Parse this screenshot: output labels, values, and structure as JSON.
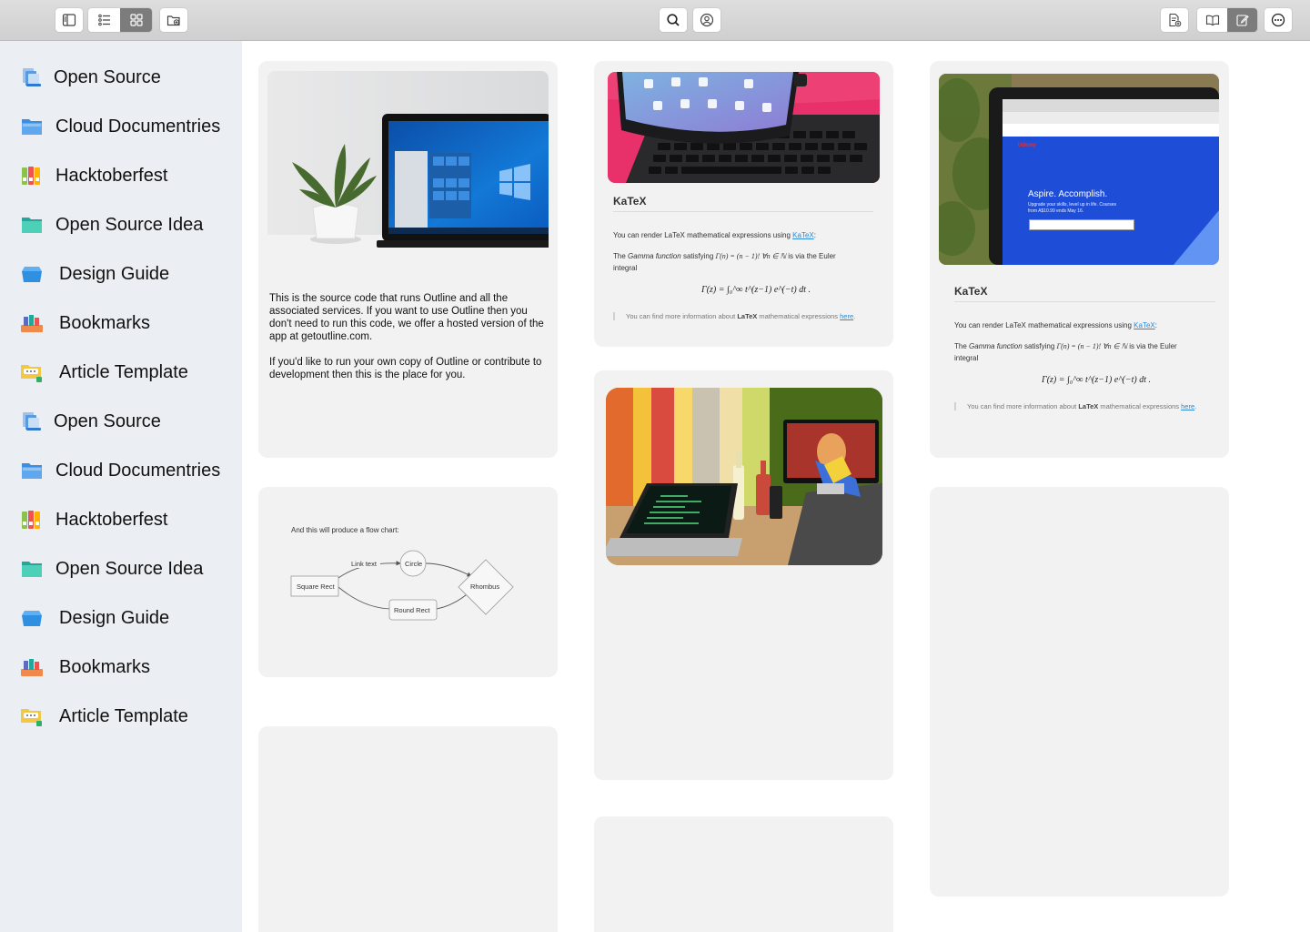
{
  "toolbar": {
    "left": [
      "sidebar-toggle-icon",
      "list-view-icon",
      "grid-view-icon",
      "new-folder-icon"
    ],
    "center": [
      "search-icon",
      "account-icon"
    ],
    "right": [
      "new-document-icon",
      "reader-mode-icon",
      "edit-mode-icon",
      "more-icon"
    ],
    "active_view": "grid",
    "active_mode": "edit"
  },
  "sidebar": {
    "items": [
      {
        "label": "Open Source",
        "icon": "document-stack-icon"
      },
      {
        "label": "Cloud Documentries",
        "icon": "blue-folder-icon"
      },
      {
        "label": "Hacktoberfest",
        "icon": "binders-icon"
      },
      {
        "label": "Open Source Idea",
        "icon": "teal-folder-icon"
      },
      {
        "label": "Design Guide",
        "icon": "open-box-icon"
      },
      {
        "label": "Bookmarks",
        "icon": "books-icon"
      },
      {
        "label": "Article Template",
        "icon": "comment-folder-icon"
      },
      {
        "label": "Open Source",
        "icon": "document-stack-icon"
      },
      {
        "label": "Cloud Documentries",
        "icon": "blue-folder-icon"
      },
      {
        "label": "Hacktoberfest",
        "icon": "binders-icon"
      },
      {
        "label": "Open Source Idea",
        "icon": "teal-folder-icon"
      },
      {
        "label": "Design Guide",
        "icon": "open-box-icon"
      },
      {
        "label": "Bookmarks",
        "icon": "books-icon"
      },
      {
        "label": "Article Template",
        "icon": "comment-folder-icon"
      }
    ]
  },
  "cards": {
    "outline": {
      "image": "laptop-with-plant-photo",
      "paragraph1": "This is the source code that runs Outline and all the associated services. If you want to use Outline then you don't need to run this code, we offer a hosted version of the app at getoutline.com.",
      "paragraph2": "If you'd like to run your own copy of Outline or contribute to development then this is the place for you."
    },
    "flowchart": {
      "intro": "And this will produce a flow chart:",
      "nodes": {
        "square": "Square Rect",
        "circle": "Circle",
        "round": "Round Rect",
        "rhombus": "Rhombus"
      },
      "edge_label": "Link text"
    },
    "katex": {
      "title": "KaTeX",
      "line1_prefix": "You can render LaTeX mathematical expressions using ",
      "line1_link": "KaTeX",
      "line1_suffix": ":",
      "line2_prefix": "The ",
      "line2_em": "Gamma function",
      "line2_mid": " satisfying ",
      "line2_math": "Γ(n) = (n − 1)!   ∀n ∈ ℕ",
      "line2_suffix": " is via the Euler",
      "line3": "integral",
      "formula": "Γ(z) = ∫₀^∞ t^(z−1) e^(−t) dt .",
      "quote_prefix": "You can find more information about ",
      "quote_bold": "LaTeX",
      "quote_mid": " mathematical expressions ",
      "quote_link": "here",
      "quote_suffix": "."
    },
    "tablet": {
      "image": "ipad-keyboard-photo"
    },
    "desk": {
      "image": "laptop-on-desk-photo"
    },
    "udemy": {
      "image": "udemy-laptop-photo",
      "headline": "Aspire. Accomplish.",
      "subline": "Upgrade your skills, level up in life. Courses from A$10.99 ends May 16.",
      "brand": "Udemy"
    }
  },
  "colors": {
    "sidebar_bg": "#ebeff3",
    "card_bg": "#f2f2f2",
    "link": "#2b88d8",
    "toolbar_active": "#7c7c7c"
  }
}
